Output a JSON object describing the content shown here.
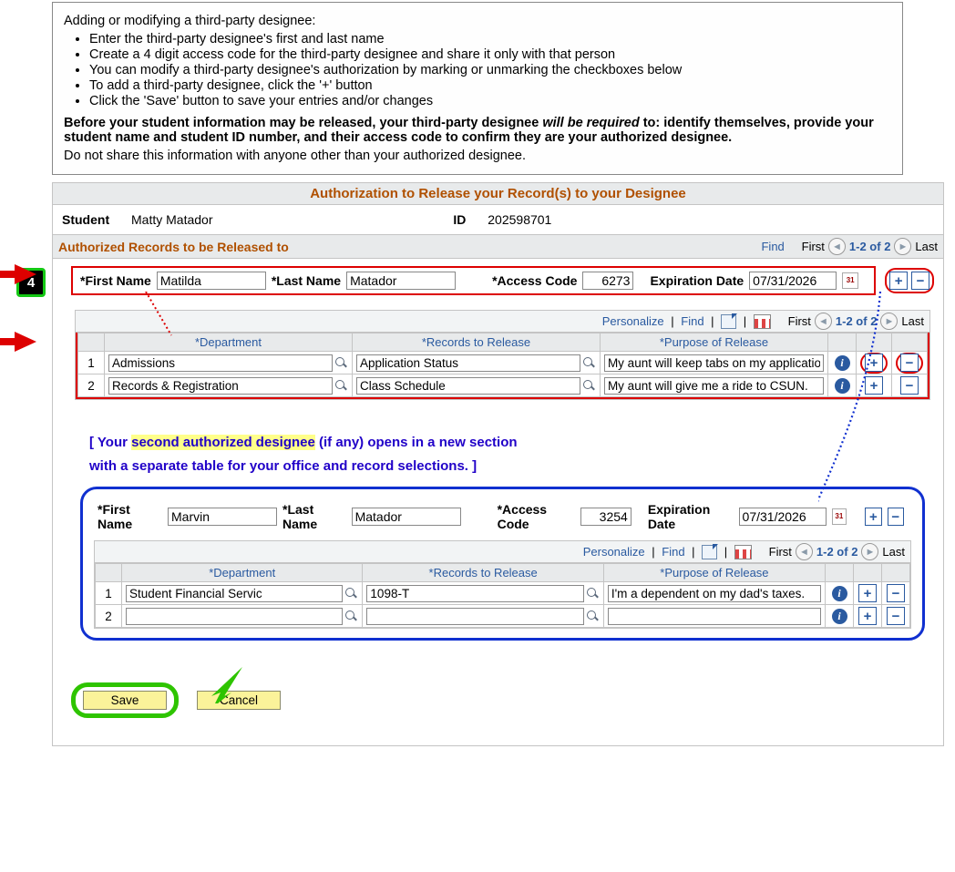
{
  "info": {
    "heading": "Adding or modifying a third-party designee:",
    "bullets": [
      "Enter the third-party designee's first and last name",
      "Create a 4 digit access code for the third-party designee and share it only with that person",
      "You can modify a third-party designee's authorization by marking or unmarking the checkboxes below",
      "To add a third-party designee, click the '+' button",
      "Click the 'Save' button to save your entries and/or changes"
    ],
    "warning_pre": "Before your student information may be released, your third-party designee ",
    "warning_will": "will be required",
    "warning_post": " to: identify themselves, provide your student name and student ID number, and their access code to confirm they are your authorized designee.",
    "share": "Do not share this information with anyone other than your authorized designee."
  },
  "step_number": "4",
  "panel_title": "Authorization to Release your Record(s) to your Designee",
  "student_label": "Student",
  "student_name": "Matty Matador",
  "id_label": "ID",
  "id_value": "202598701",
  "subsection_title": "Authorized Records to be Released to",
  "nav": {
    "find": "Find",
    "first": "First",
    "last": "Last",
    "range": "1-2 of 2",
    "personalize": "Personalize"
  },
  "labels": {
    "first_name": "*First Name",
    "last_name": "*Last Name",
    "access_code": "*Access Code",
    "expiration": "Expiration Date",
    "dept": "Department",
    "records": "Records to Release",
    "purpose": "Purpose of Release"
  },
  "designees": [
    {
      "first_name": "Matilda",
      "last_name": "Matador",
      "access_code": "6273",
      "expiration": "07/31/2026",
      "rows": [
        {
          "n": "1",
          "dept": "Admissions",
          "records": "Application Status",
          "purpose": "My aunt will keep tabs on my application."
        },
        {
          "n": "2",
          "dept": "Records & Registration",
          "records": "Class Schedule",
          "purpose": "My aunt will give me a ride to CSUN."
        }
      ]
    },
    {
      "first_name": "Marvin",
      "last_name": "Matador",
      "access_code": "3254",
      "expiration": "07/31/2026",
      "rows": [
        {
          "n": "1",
          "dept": "Student Financial Servic",
          "records": "1098-T",
          "purpose": "I'm a dependent on my dad's taxes."
        },
        {
          "n": "2",
          "dept": "",
          "records": "",
          "purpose": ""
        }
      ]
    }
  ],
  "annotation_l1a": "[ Your ",
  "annotation_l1b": "second authorized designee",
  "annotation_l1c": " (if any) opens in a new section",
  "annotation_l2": "with a separate table for your office and record selections. ]",
  "buttons": {
    "save": "Save",
    "cancel": "Cancel"
  }
}
